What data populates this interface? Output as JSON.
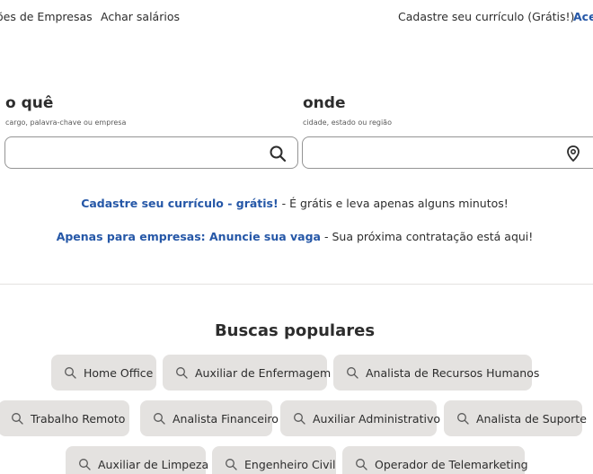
{
  "nav": {
    "left": [
      "ões de Empresas",
      "Achar salários"
    ],
    "right": [
      "Cadastre seu currículo (Grátis!)",
      "Ace"
    ]
  },
  "search": {
    "what_label": "o quê",
    "what_hint": "cargo, palavra-chave ou empresa",
    "what_value": "",
    "where_label": "onde",
    "where_hint": "cidade, estado ou região",
    "where_value": ""
  },
  "promo": {
    "resume_link": "Cadastre seu currículo - grátis!",
    "resume_text": " - É grátis e leva apenas alguns minutos!",
    "employer_link": "Apenas para empresas: Anuncie sua vaga",
    "employer_text": " - Sua próxima contratação está aqui!"
  },
  "popular": {
    "title": "Buscas populares",
    "items": [
      "Home Office",
      "Auxiliar de Enfermagem",
      "Analista de Recursos Humanos",
      "Trabalho Remoto",
      "Analista Financeiro",
      "Auxiliar Administrativo",
      "Analista de Suporte",
      "Auxiliar de Limpeza",
      "Engenheiro Civil",
      "Operador de Telemarketing"
    ]
  },
  "colors": {
    "link": "#2557a7",
    "chip": "#e4e2e0",
    "text": "#2d2d2d"
  },
  "icons": [
    "search-icon",
    "location-pin-icon"
  ]
}
